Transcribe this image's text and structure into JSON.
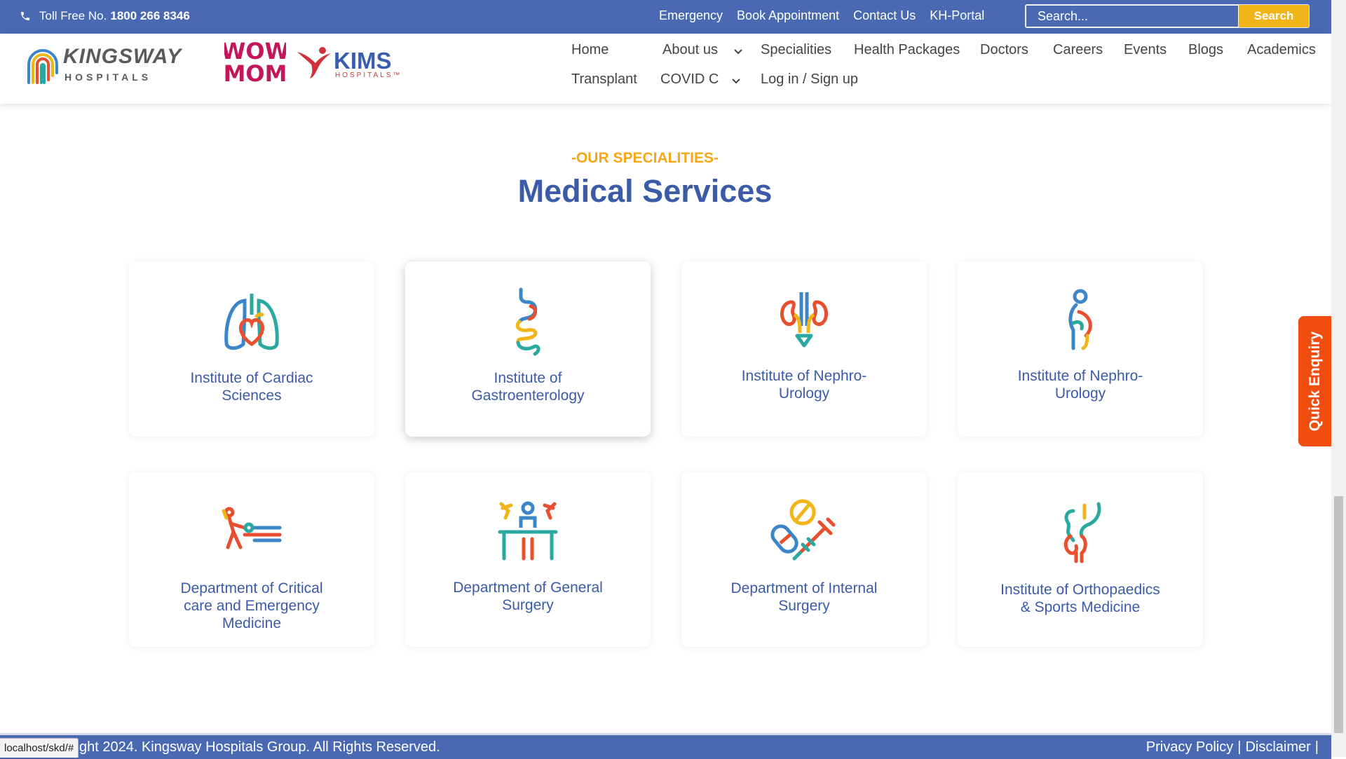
{
  "topbar": {
    "toll_label": "Toll Free No.",
    "toll_number": "1800 266 8346",
    "links": [
      "Emergency",
      "Book Appointment",
      "Contact Us",
      "KH-Portal"
    ],
    "search_placeholder": "Search...",
    "search_button": "Search"
  },
  "logos": {
    "kingsway_line1": "KINGSWAY",
    "kingsway_line2": "HOSPITALS",
    "wow_line1": "WOW",
    "wow_line2": "MOM",
    "kims_line1": "KIMS",
    "kims_line2": "HOSPITALS™"
  },
  "nav": {
    "home": "Home",
    "about": "About us",
    "specialities": "Specialities",
    "health_packages": "Health Packages",
    "doctors": "Doctors",
    "careers": "Careers",
    "events": "Events",
    "blogs": "Blogs",
    "academics": "Academics",
    "transplant": "Transplant",
    "covid": "COVID Ca",
    "login": "Log in / Sign up"
  },
  "section": {
    "eyebrow": "-OUR SPECIALITIES-",
    "heading": "Medical Services"
  },
  "cards": [
    {
      "icon": "lungs-heart-icon",
      "line1": "Institute of Cardiac",
      "line2": "Sciences",
      "line3": ""
    },
    {
      "icon": "stomach-intestine-icon",
      "line1": "Institute of",
      "line2": "Gastroenterology",
      "line3": ""
    },
    {
      "icon": "kidney-icon",
      "line1": "Institute of Nephro-",
      "line2": "Urology",
      "line3": ""
    },
    {
      "icon": "pregnancy-icon",
      "line1": "Institute of Nephro-",
      "line2": "Urology",
      "line3": ""
    },
    {
      "icon": "stretcher-icon",
      "line1": "Department of Critical",
      "line2": "care and Emergency",
      "line3": "Medicine"
    },
    {
      "icon": "surgery-team-icon",
      "line1": "Department of General",
      "line2": "Surgery",
      "line3": ""
    },
    {
      "icon": "pill-syringe-icon",
      "line1": "Department of Internal",
      "line2": "Surgery",
      "line3": ""
    },
    {
      "icon": "joint-bone-icon",
      "line1": "Institute of Orthopaedics",
      "line2": "& Sports Medicine",
      "line3": ""
    }
  ],
  "quick_enquiry": "Quick Enquiry",
  "footer": {
    "copyright": "ght 2024. Kingsway Hospitals Group. All Rights Reserved.",
    "privacy": "Privacy Policy",
    "sep1": "|",
    "disclaimer": "Disclaimer",
    "sep2": "|"
  },
  "status_url": "localhost/skd/#",
  "colors": {
    "brand_blue": "#4a69b3",
    "accent_yellow": "#f2b519",
    "eyebrow_orange": "#f4a817",
    "enquiry_orange": "#f24d10"
  }
}
